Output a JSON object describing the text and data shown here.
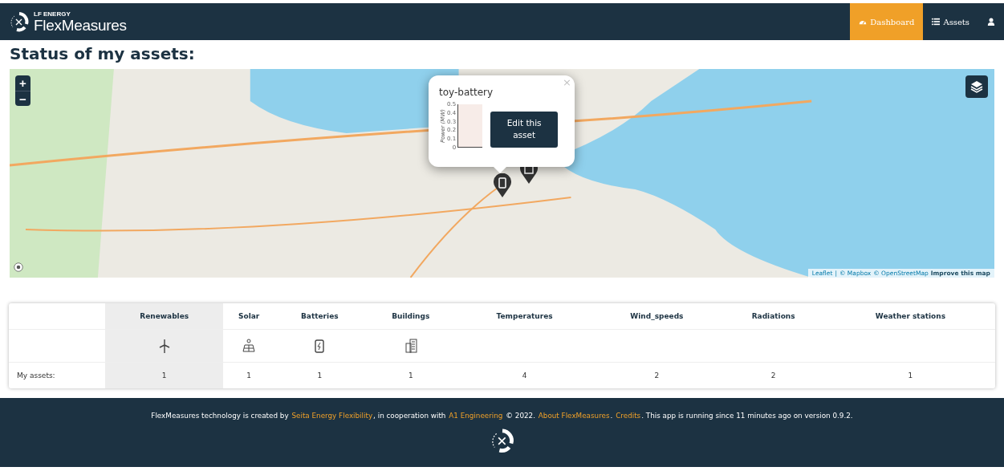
{
  "navbar": {
    "brand_small": "LF ENERGY",
    "brand": "FlexMeasures",
    "items": [
      {
        "label": "Dashboard",
        "kind": "dashboard",
        "selected": true
      },
      {
        "label": "Assets",
        "kind": "list",
        "selected": false
      },
      {
        "kind": "user",
        "selected": false
      }
    ]
  },
  "page_title": "Status of my assets:",
  "map": {
    "zoom_in": "+",
    "zoom_out": "−",
    "attribution": [
      {
        "text": "Leaflet",
        "bold": false
      },
      {
        "text": "|",
        "bold": false
      },
      {
        "text": "© Mapbox",
        "bold": false
      },
      {
        "text": "© OpenStreetMap",
        "bold": false
      },
      {
        "text": "Improve this map",
        "bold": true
      }
    ],
    "popup": {
      "title": "toy-battery",
      "close": "×",
      "button": "Edit this asset",
      "chart": {
        "axis_label": "Power (MW)",
        "tick_labels": [
          "0.5",
          "0.4",
          "0.3",
          "0.2",
          "0.1",
          "0"
        ]
      }
    }
  },
  "table": {
    "columns": [
      {
        "label": "Renewables",
        "selected": true
      },
      {
        "label": "Solar",
        "selected": false
      },
      {
        "label": "Batteries",
        "selected": false
      },
      {
        "label": "Buildings",
        "selected": false
      },
      {
        "label": "Temperatures",
        "selected": false
      },
      {
        "label": "Wind_speeds",
        "selected": false
      },
      {
        "label": "Radiations",
        "selected": false
      },
      {
        "label": "Weather stations",
        "selected": false
      }
    ],
    "row_label": "My assets:",
    "counts": [
      "1",
      "1",
      "1",
      "1",
      "4",
      "2",
      "2",
      "1"
    ]
  },
  "footer": {
    "segments": [
      {
        "text": "FlexMeasures technology is created by ",
        "link": false
      },
      {
        "text": "Seita Energy Flexibility",
        "link": true
      },
      {
        "text": ", in cooperation with ",
        "link": false
      },
      {
        "text": "A1 Engineering",
        "link": true
      },
      {
        "text": " © 2022. ",
        "link": false
      },
      {
        "text": "About FlexMeasures",
        "link": true
      },
      {
        "text": ". ",
        "link": false
      },
      {
        "text": "Credits",
        "link": true
      },
      {
        "text": ". This app is running since 11 minutes ago on version 0.9.2.",
        "link": false
      }
    ]
  }
}
